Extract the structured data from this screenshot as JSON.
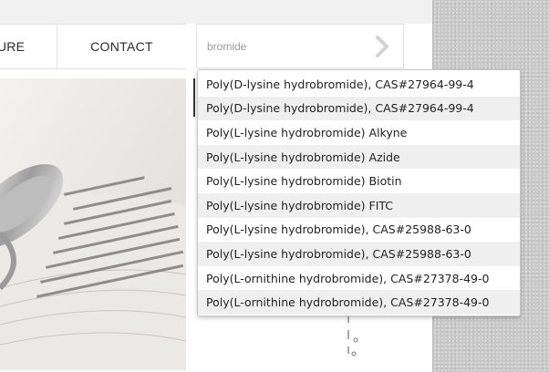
{
  "nav": {
    "partial_item": "TURE",
    "contact": "CONTACT"
  },
  "search": {
    "value": "bromide",
    "submit_icon": "chevron-right-icon"
  },
  "dropdown": {
    "items": [
      "Poly(D-lysine hydrobromide), CAS#27964-99-4",
      "Poly(D-lysine hydrobromide), CAS#27964-99-4",
      "Poly(L-lysine hydrobromide) Alkyne",
      "Poly(L-lysine hydrobromide) Azide",
      "Poly(L-lysine hydrobromide) Biotin",
      "Poly(L-lysine hydrobromide) FITC",
      "Poly(L-lysine hydrobromide), CAS#25988-63-0",
      "Poly(L-lysine hydrobromide), CAS#25988-63-0",
      "Poly(L-ornithine hydrobromide), CAS#27378-49-0",
      "Poly(L-ornithine hydrobromide), CAS#27378-49-0"
    ]
  },
  "colors": {
    "accent_text": "#2b2b2b",
    "alt_row": "#efefef",
    "gutter": "#c9c9c9"
  }
}
